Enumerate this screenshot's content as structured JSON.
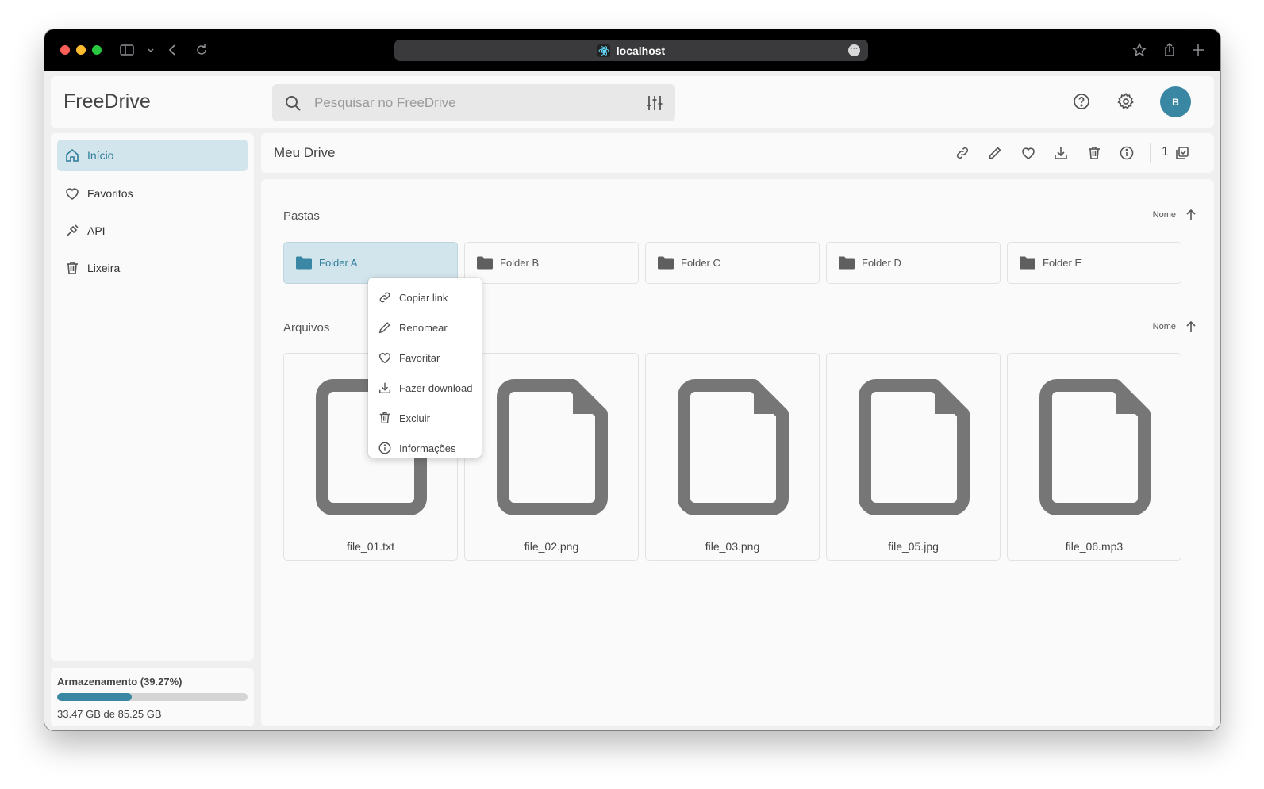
{
  "browser": {
    "url": "localhost"
  },
  "header": {
    "brand": "FreeDrive",
    "search_placeholder": "Pesquisar no FreeDrive",
    "avatar_initial": "B"
  },
  "sidebar": {
    "items": [
      {
        "label": "Início",
        "icon": "home-icon",
        "active": true
      },
      {
        "label": "Favoritos",
        "icon": "heart-icon",
        "active": false
      },
      {
        "label": "API",
        "icon": "plug-icon",
        "active": false
      },
      {
        "label": "Lixeira",
        "icon": "trash-icon",
        "active": false
      }
    ],
    "storage": {
      "title": "Armazenamento (39.27%)",
      "used_fraction": 0.3927,
      "text": "33.47 GB de 85.25 GB"
    }
  },
  "toolbar": {
    "title": "Meu Drive",
    "selection_count": "1",
    "actions": [
      "link-icon",
      "pencil-icon",
      "heart-icon",
      "download-icon",
      "trash-icon",
      "info-icon"
    ]
  },
  "folders": {
    "section_title": "Pastas",
    "sort_label": "Nome",
    "items": [
      {
        "name": "Folder A",
        "selected": true
      },
      {
        "name": "Folder B",
        "selected": false
      },
      {
        "name": "Folder C",
        "selected": false
      },
      {
        "name": "Folder D",
        "selected": false
      },
      {
        "name": "Folder E",
        "selected": false
      }
    ]
  },
  "files": {
    "section_title": "Arquivos",
    "sort_label": "Nome",
    "items": [
      {
        "name": "file_01.txt"
      },
      {
        "name": "file_02.png"
      },
      {
        "name": "file_03.png"
      },
      {
        "name": "file_05.jpg"
      },
      {
        "name": "file_06.mp3"
      }
    ]
  },
  "context_menu": {
    "items": [
      {
        "label": "Copiar link",
        "icon": "link-icon"
      },
      {
        "label": "Renomear",
        "icon": "pencil-icon"
      },
      {
        "label": "Favoritar",
        "icon": "heart-icon"
      },
      {
        "label": "Fazer download",
        "icon": "download-icon"
      },
      {
        "label": "Excluir",
        "icon": "trash-icon"
      },
      {
        "label": "Informações",
        "icon": "info-icon"
      }
    ]
  },
  "colors": {
    "accent": "#3a87a4",
    "selected_bg": "#d3e5ec"
  }
}
